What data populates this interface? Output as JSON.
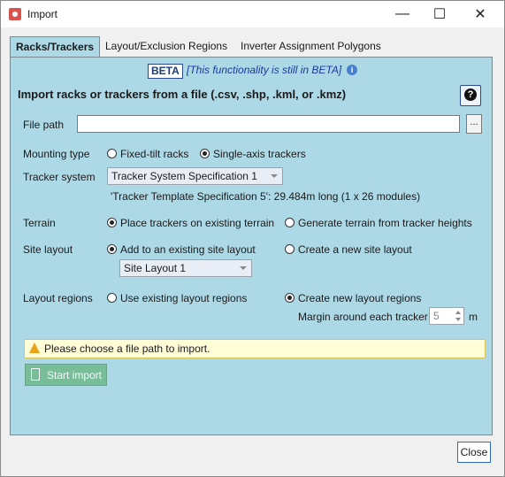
{
  "window": {
    "title": "Import",
    "minimize_glyph": "—",
    "maximize_glyph": "☐",
    "close_glyph": "✕"
  },
  "tabs": [
    {
      "label": "Racks/Trackers",
      "active": true
    },
    {
      "label": "Layout/Exclusion Regions",
      "active": false
    },
    {
      "label": "Inverter Assignment Polygons",
      "active": false
    }
  ],
  "beta": {
    "badge": "BETA",
    "note": "[This functionality is still in BETA]",
    "info_glyph": "i"
  },
  "heading": "Import racks or trackers from a file (.csv, .shp, .kml, or .kmz)",
  "file_path": {
    "label": "File path",
    "value": "",
    "browse_label": "..."
  },
  "mounting_type": {
    "label": "Mounting type",
    "options": [
      "Fixed-tilt racks",
      "Single-axis trackers"
    ],
    "selected": "Single-axis trackers"
  },
  "tracker_system": {
    "label": "Tracker system",
    "selected": "Tracker System Specification 1",
    "info": "'Tracker Template Specification 5':  29.484m long (1 x 26 modules)"
  },
  "terrain": {
    "label": "Terrain",
    "options": [
      "Place trackers on existing terrain",
      "Generate terrain from tracker heights"
    ],
    "selected": "Place trackers on existing terrain"
  },
  "site_layout": {
    "label": "Site layout",
    "options": [
      "Add to an existing site layout",
      "Create a new site layout"
    ],
    "selected": "Add to an existing site layout",
    "layout_selected": "Site Layout 1"
  },
  "layout_regions": {
    "label": "Layout regions",
    "options": [
      "Use existing layout regions",
      "Create new layout regions"
    ],
    "selected": "Create new layout regions",
    "margin_label": "Margin around each tracker",
    "margin_value": "5",
    "margin_unit": "m"
  },
  "warning": {
    "text": "Please choose a file path to import."
  },
  "buttons": {
    "start_import": "Start import",
    "close": "Close",
    "help": "?"
  },
  "colors": {
    "panel": "#add8e6",
    "beta_text": "#1a3aa0",
    "warning_bg": "#fffdd8",
    "start_button": "#6fb98a",
    "close_border": "#2a66cc"
  }
}
